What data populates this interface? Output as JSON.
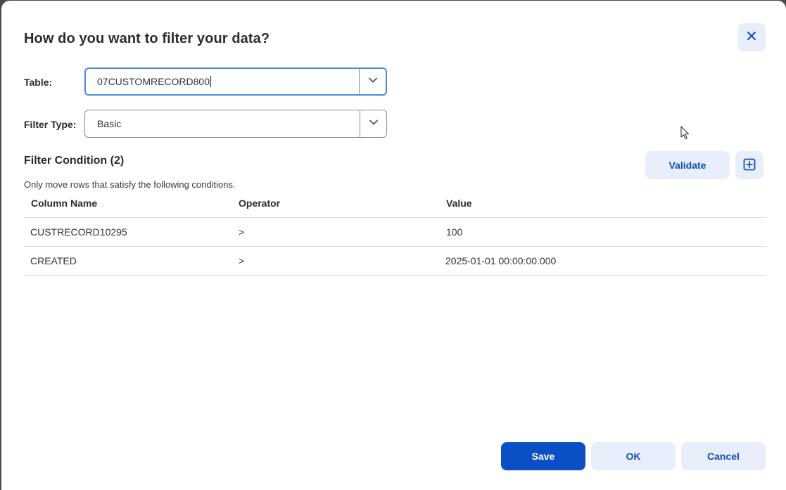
{
  "dialog": {
    "title": "How do you want to filter your data?",
    "close_icon": "close-icon"
  },
  "table_field": {
    "label": "Table:",
    "value": "07CUSTOMRECORD800",
    "chevron_icon": "chevron-down-icon"
  },
  "filter_type_field": {
    "label": "Filter Type:",
    "value": "Basic",
    "chevron_icon": "chevron-down-icon"
  },
  "filter_condition": {
    "title": "Filter Condition (2)",
    "description": "Only move rows that satisfy the following conditions.",
    "validate_label": "Validate",
    "add_icon": "add-square-icon",
    "columns": [
      "Column Name",
      "Operator",
      "Value"
    ],
    "rows": [
      {
        "column": "CUSTRECORD10295",
        "operator": ">",
        "value": "100"
      },
      {
        "column": "CREATED",
        "operator": ">",
        "value": "2025-01-01 00:00:00.000"
      }
    ]
  },
  "footer": {
    "save_label": "Save",
    "ok_label": "OK",
    "cancel_label": "Cancel"
  },
  "colors": {
    "primary": "#0b4fc6",
    "secondary_bg": "#e8effa",
    "focus_border": "#4a8be0"
  }
}
